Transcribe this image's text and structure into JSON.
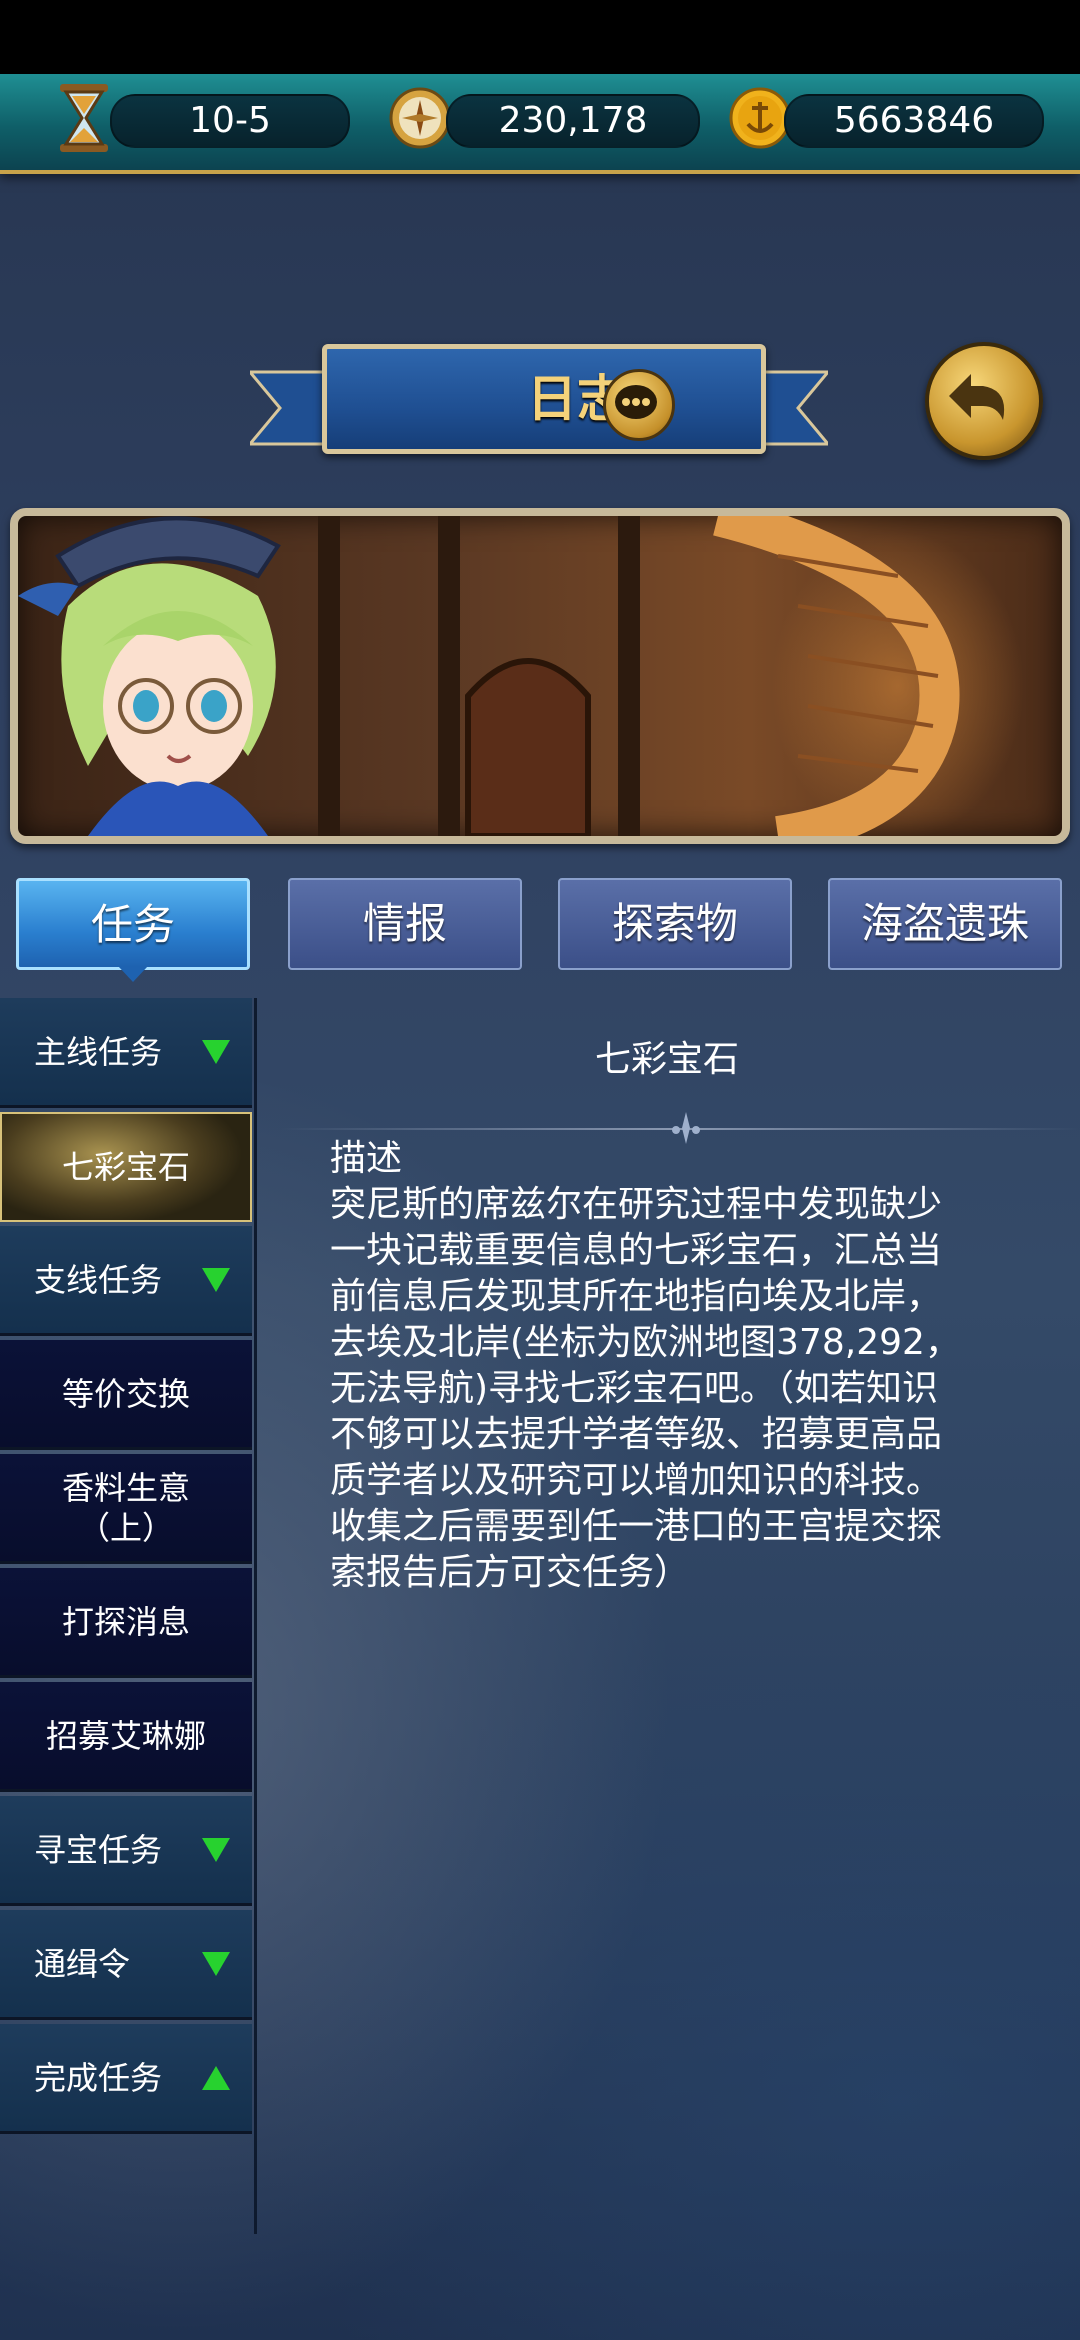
{
  "resources": [
    {
      "icon": "hourglass-icon",
      "value": "10-5"
    },
    {
      "icon": "compass-icon",
      "value": "230,178"
    },
    {
      "icon": "anchor-coin-icon",
      "value": "5663846"
    }
  ],
  "title": "日志",
  "tabs": [
    "任务",
    "情报",
    "探索物",
    "海盗遗珠"
  ],
  "sidebar": [
    {
      "label": "主线任务",
      "type": "header",
      "arrow": "down"
    },
    {
      "label": "七彩宝石",
      "type": "selected"
    },
    {
      "label": "支线任务",
      "type": "header",
      "arrow": "down"
    },
    {
      "label": "等价交换",
      "type": "sub"
    },
    {
      "label": "香料生意\n（上）",
      "type": "sub"
    },
    {
      "label": "打探消息",
      "type": "sub"
    },
    {
      "label": "招募艾琳娜",
      "type": "sub"
    },
    {
      "label": "寻宝任务",
      "type": "header",
      "arrow": "down"
    },
    {
      "label": "通缉令",
      "type": "header",
      "arrow": "down"
    },
    {
      "label": "完成任务",
      "type": "header",
      "arrow": "up"
    }
  ],
  "detail": {
    "title": "七彩宝石",
    "desc_label": "描述",
    "description": "突尼斯的席兹尔在研究过程中发现缺少\n一块记载重要信息的七彩宝石，汇总当\n前信息后发现其所在地指向埃及北岸，\n去埃及北岸(坐标为欧洲地图378,292，\n无法导航)寻找七彩宝石吧。（如若知识\n不够可以去提升学者等级、招募更高品\n质学者以及研究可以增加知识的科技。\n收集之后需要到任一港口的王宫提交探\n索报告后方可交任务）"
  },
  "colors": {
    "accent_gold": "#f4d27a",
    "tab_active": "#2a7fcf",
    "arrow_green": "#27d22f"
  }
}
